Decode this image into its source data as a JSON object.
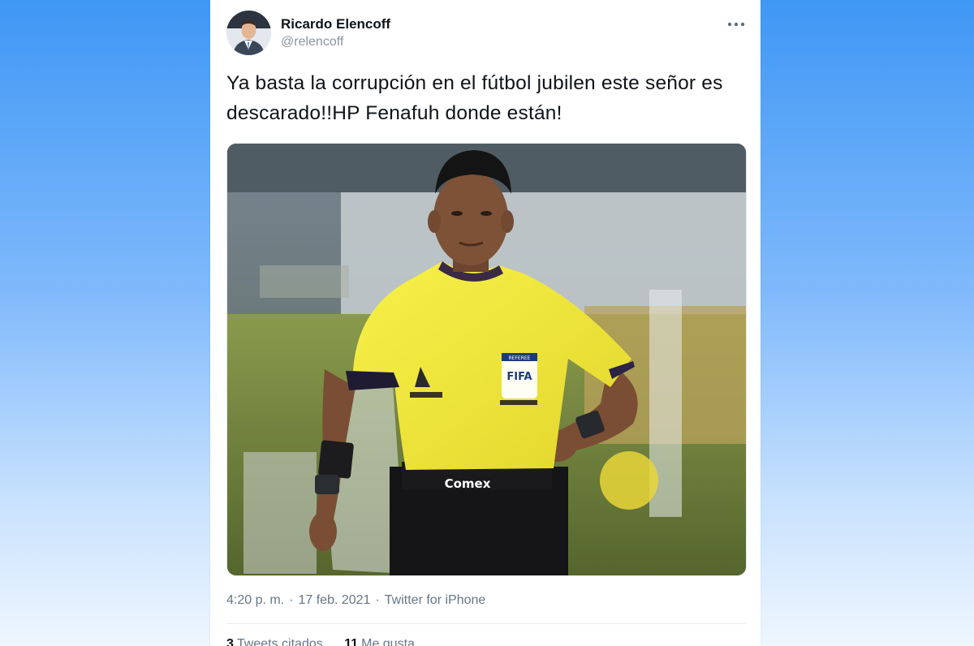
{
  "tweet": {
    "author_name": "Ricardo Elencoff",
    "author_handle": "@relencoff",
    "text": "Ya basta la corrupción en el fútbol jubilen este señor es descarado!!HP Fenafuh donde están!",
    "time": "4:20 p. m.",
    "date": "17 feb. 2021",
    "separator": "·",
    "source": "Twitter for iPhone",
    "more_icon": "more-horizontal-icon"
  },
  "media": {
    "jersey_sponsor": "Comex",
    "badge_top": "REFEREE",
    "badge_main": "FIFA"
  },
  "stats": [
    {
      "count": "3",
      "label": "Tweets citados"
    },
    {
      "count": "11",
      "label": "Me gusta"
    }
  ],
  "colors": {
    "background_top": "#3f97f5",
    "background_bottom": "#eef6fe",
    "card": "#ffffff",
    "text": "#0f1419",
    "muted": "#657786",
    "jersey": "#f4ee3c"
  }
}
